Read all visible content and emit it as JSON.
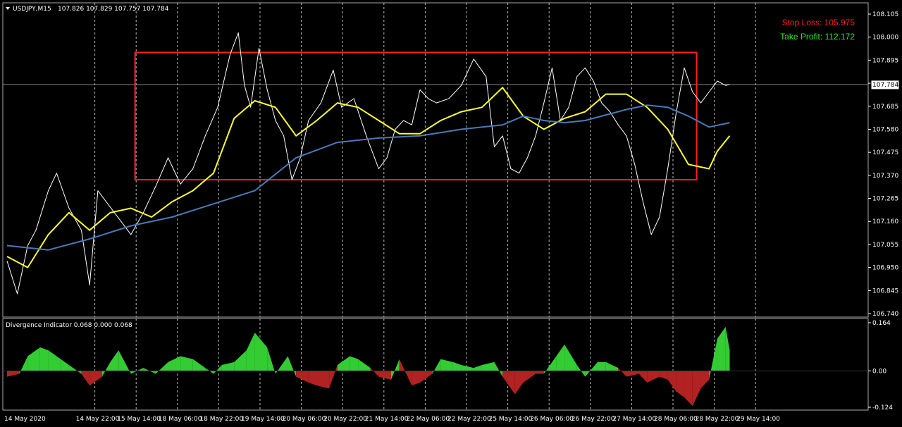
{
  "header": {
    "symbol": "USDJPY,M15",
    "ohlc": "107.826 107.829 107.757 107.784"
  },
  "orders": {
    "stop_loss": "Stop Loss: 105.975",
    "take_profit": "Take Profit: 112.172"
  },
  "current_price": "107.784",
  "indicator_label": "Divergence Indicator 0.068 0.000 0.068",
  "colors": {
    "background": "#000000",
    "price": "#ffffff",
    "ma_fast": "#ffff33",
    "ma_slow": "#4a7ab8",
    "hist_pos": "#33cc33",
    "hist_neg": "#b22222",
    "range_box": "#ff2020",
    "stop_loss": "#ff2020",
    "take_profit": "#22ee22"
  },
  "chart_data": [
    {
      "type": "line",
      "ylim": [
        106.74,
        108.16
      ],
      "y_ticks": [
        "108.105",
        "108.000",
        "107.895",
        "107.790",
        "107.685",
        "107.580",
        "107.475",
        "107.370",
        "107.265",
        "107.160",
        "107.055",
        "106.950",
        "106.845",
        "106.740"
      ],
      "x_ticks": [
        "14 May 2020",
        "14 May 22:00",
        "15 May 14:00",
        "18 May 06:00",
        "18 May 22:00",
        "19 May 14:00",
        "20 May 06:00",
        "20 May 22:00",
        "21 May 14:00",
        "22 May 06:00",
        "22 May 22:00",
        "25 May 14:00",
        "26 May 06:00",
        "26 May 22:00",
        "27 May 14:00",
        "28 May 06:00",
        "28 May 22:00",
        "29 May 14:00"
      ],
      "range_box": {
        "x0": 3.1,
        "x1": 16.7,
        "y_top": 107.93,
        "y_bottom": 107.35
      },
      "series": [
        {
          "key": "price",
          "x": [
            0,
            0.25,
            0.5,
            0.7,
            1.0,
            1.2,
            1.5,
            1.8,
            2.0,
            2.2,
            2.4,
            2.6,
            3.0,
            3.3,
            3.6,
            3.9,
            4.2,
            4.5,
            4.8,
            5.1,
            5.4,
            5.6,
            5.75,
            5.9,
            6.1,
            6.3,
            6.5,
            6.7,
            6.9,
            7.1,
            7.3,
            7.6,
            7.9,
            8.1,
            8.4,
            8.7,
            9.0,
            9.2,
            9.4,
            9.6,
            9.8,
            10.0,
            10.2,
            10.4,
            10.7,
            11.0,
            11.3,
            11.6,
            11.8,
            12.0,
            12.2,
            12.4,
            12.6,
            12.8,
            13.0,
            13.2,
            13.4,
            13.6,
            13.8,
            14.0,
            14.2,
            14.4,
            14.6,
            14.8,
            15.0,
            15.2,
            15.4,
            15.6,
            15.8,
            16.0,
            16.2,
            16.4,
            16.6,
            16.8,
            17.0,
            17.2,
            17.4,
            17.5
          ],
          "values": [
            106.98,
            106.83,
            107.05,
            107.12,
            107.3,
            107.38,
            107.22,
            107.12,
            106.87,
            107.3,
            107.25,
            107.2,
            107.1,
            107.2,
            107.32,
            107.45,
            107.33,
            107.4,
            107.55,
            107.68,
            107.92,
            108.02,
            107.78,
            107.68,
            107.95,
            107.76,
            107.62,
            107.55,
            107.35,
            107.45,
            107.62,
            107.7,
            107.85,
            107.68,
            107.72,
            107.55,
            107.4,
            107.45,
            107.58,
            107.62,
            107.6,
            107.76,
            107.72,
            107.7,
            107.72,
            107.78,
            107.9,
            107.82,
            107.5,
            107.55,
            107.4,
            107.38,
            107.45,
            107.55,
            107.7,
            107.86,
            107.62,
            107.68,
            107.82,
            107.86,
            107.8,
            107.7,
            107.66,
            107.6,
            107.55,
            107.42,
            107.25,
            107.1,
            107.18,
            107.4,
            107.65,
            107.86,
            107.75,
            107.7,
            107.75,
            107.8,
            107.78,
            107.784
          ]
        },
        {
          "key": "ma_fast",
          "x": [
            0,
            0.5,
            1.0,
            1.5,
            2.0,
            2.5,
            3.0,
            3.5,
            4.0,
            4.5,
            5.0,
            5.5,
            6.0,
            6.5,
            7.0,
            7.5,
            8.0,
            8.5,
            9.0,
            9.5,
            10.0,
            10.5,
            11.0,
            11.5,
            12.0,
            12.5,
            13.0,
            13.5,
            14.0,
            14.5,
            15.0,
            15.5,
            16.0,
            16.5,
            17.0,
            17.2,
            17.5
          ],
          "values": [
            107.0,
            106.95,
            107.1,
            107.2,
            107.12,
            107.2,
            107.22,
            107.18,
            107.25,
            107.3,
            107.38,
            107.63,
            107.71,
            107.68,
            107.55,
            107.62,
            107.7,
            107.68,
            107.62,
            107.56,
            107.56,
            107.62,
            107.66,
            107.68,
            107.77,
            107.64,
            107.58,
            107.63,
            107.66,
            107.74,
            107.74,
            107.68,
            107.58,
            107.42,
            107.4,
            107.48,
            107.55
          ]
        },
        {
          "key": "ma_slow",
          "x": [
            0,
            1,
            2,
            3,
            4,
            5,
            6,
            7,
            8,
            9,
            10,
            11,
            12,
            12.5,
            13,
            13.5,
            14,
            15,
            15.5,
            16,
            16.5,
            17,
            17.5
          ],
          "values": [
            107.05,
            107.03,
            107.08,
            107.14,
            107.18,
            107.24,
            107.3,
            107.45,
            107.52,
            107.54,
            107.55,
            107.58,
            107.6,
            107.64,
            107.62,
            107.61,
            107.62,
            107.67,
            107.69,
            107.68,
            107.64,
            107.59,
            107.61
          ]
        }
      ]
    },
    {
      "type": "bar",
      "title": "Divergence Indicator 0.068 0.000 0.068",
      "ylim": [
        -0.124,
        0.164
      ],
      "y_ticks": [
        "0.164",
        "0.00",
        "-0.124"
      ],
      "series": [
        {
          "key": "divergence",
          "x": [
            0,
            0.3,
            0.5,
            0.8,
            1.0,
            1.3,
            1.5,
            1.8,
            2.0,
            2.3,
            2.5,
            2.7,
            3.0,
            3.3,
            3.6,
            3.9,
            4.2,
            4.5,
            4.8,
            5.0,
            5.2,
            5.5,
            5.8,
            6.0,
            6.3,
            6.5,
            6.8,
            7.0,
            7.3,
            7.5,
            7.8,
            8.0,
            8.3,
            8.5,
            8.8,
            9.0,
            9.3,
            9.5,
            9.8,
            10.0,
            10.3,
            10.5,
            10.8,
            11.0,
            11.3,
            11.5,
            11.8,
            12.0,
            12.3,
            12.5,
            12.8,
            13.0,
            13.3,
            13.5,
            13.8,
            14.0,
            14.3,
            14.5,
            14.8,
            15.0,
            15.3,
            15.5,
            15.8,
            16.0,
            16.2,
            16.4,
            16.6,
            16.8,
            17.0,
            17.2,
            17.4,
            17.5
          ],
          "values": [
            -0.02,
            -0.01,
            0.05,
            0.08,
            0.07,
            0.04,
            0.02,
            -0.01,
            -0.05,
            -0.02,
            0.03,
            0.07,
            -0.01,
            0.01,
            -0.01,
            0.03,
            0.05,
            0.04,
            0.01,
            -0.01,
            0.02,
            0.03,
            0.07,
            0.13,
            0.08,
            -0.01,
            0.05,
            -0.02,
            -0.04,
            -0.05,
            -0.06,
            0.02,
            0.05,
            0.04,
            0.01,
            -0.02,
            -0.03,
            0.04,
            -0.05,
            -0.04,
            -0.01,
            0.04,
            0.03,
            0.02,
            0.01,
            0.02,
            0.03,
            -0.02,
            -0.08,
            -0.04,
            -0.01,
            -0.01,
            0.05,
            0.09,
            0.02,
            -0.02,
            0.03,
            0.03,
            0.01,
            -0.02,
            -0.01,
            -0.04,
            -0.02,
            -0.03,
            -0.07,
            -0.09,
            -0.12,
            -0.06,
            -0.03,
            0.11,
            0.15,
            0.07
          ]
        }
      ]
    }
  ]
}
